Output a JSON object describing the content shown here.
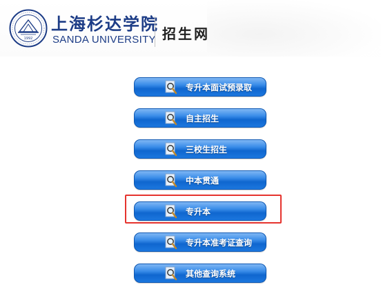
{
  "header": {
    "university_cn": "上海杉达学院",
    "university_en": "SANDA UNIVERSITY",
    "site_title": "招生网",
    "seal_year": "1992",
    "colors": {
      "brand": "#1c3c86"
    }
  },
  "menu": {
    "items": [
      {
        "label": "专升本面试预录取",
        "icon": "magnifier-doc-icon"
      },
      {
        "label": "自主招生",
        "icon": "magnifier-doc-icon"
      },
      {
        "label": "三校生招生",
        "icon": "magnifier-doc-icon"
      },
      {
        "label": "中本贯通",
        "icon": "magnifier-doc-icon"
      },
      {
        "label": "专升本",
        "icon": "magnifier-doc-icon",
        "highlighted": true
      },
      {
        "label": "专升本准考证查询",
        "icon": "magnifier-doc-icon"
      },
      {
        "label": "其他查询系统",
        "icon": "magnifier-doc-icon"
      }
    ],
    "colors": {
      "button": "#1c77de",
      "highlight_border": "#e5322d"
    }
  }
}
